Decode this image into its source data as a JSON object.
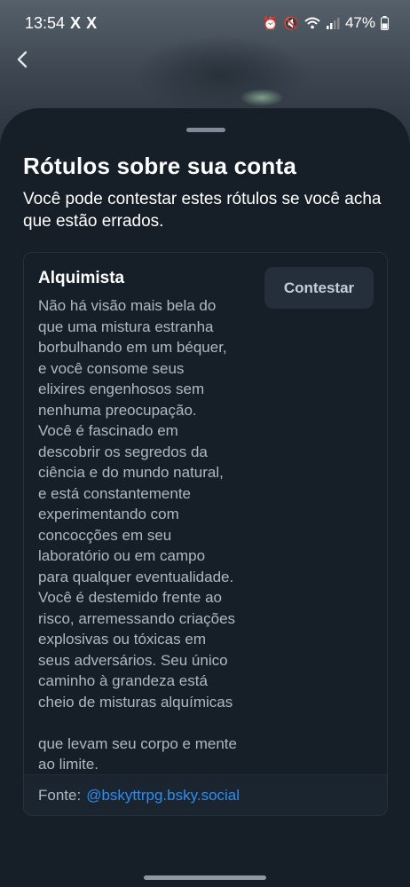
{
  "status_bar": {
    "time": "13:54",
    "x_icons": [
      "X",
      "X"
    ],
    "battery": "47%"
  },
  "sheet": {
    "title": "Rótulos sobre sua conta",
    "subtitle": "Você pode contestar estes rótulos se você acha que estão errados."
  },
  "label": {
    "name": "Alquimista",
    "description": "Não há visão mais bela do\nque uma mistura estranha\nborbulhando em um béquer,\ne você consome seus\nelixires engenhosos sem\nnenhuma preocupação.\nVocê é fascinado em\ndescobrir os segredos da\nciência e do mundo natural,\ne está constantemente\nexperimentando com\nconcocções em seu\nlaboratório ou em campo\npara qualquer eventualidade.\nVocê é destemido frente ao\nrisco, arremessando criações\nexplosivas ou tóxicas em\nseus adversários. Seu único\ncaminho à grandeza está\ncheio de misturas alquímicas\n\nque levam seu corpo e mente\nao limite.",
    "contest_label": "Contestar",
    "source_prefix": "Fonte:",
    "source_handle": "@bskyttrpg.bsky.social"
  },
  "colors": {
    "background": "#161e27",
    "link": "#2f8cf0",
    "muted_text": "#aeb8c4"
  }
}
